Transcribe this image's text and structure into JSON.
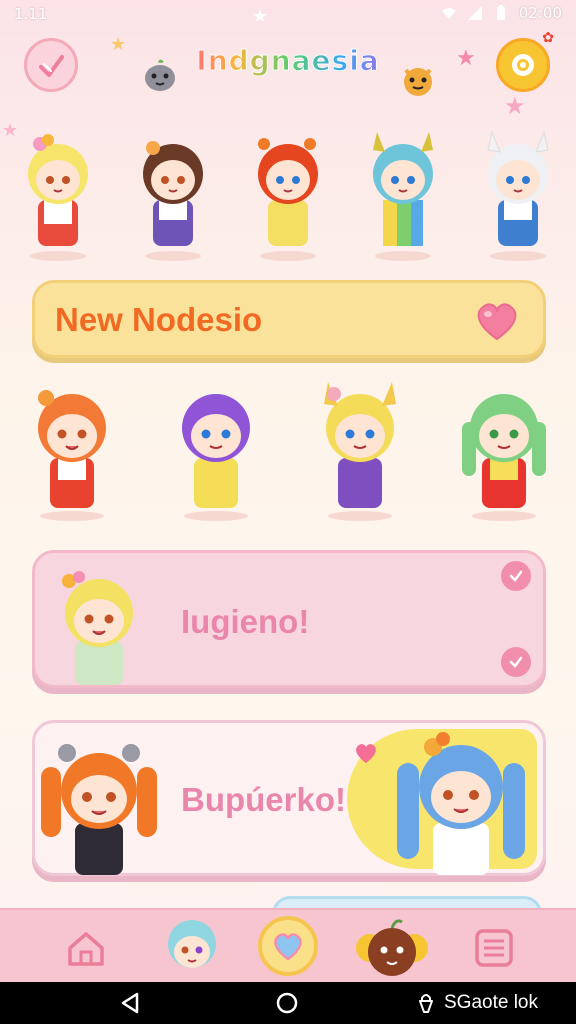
{
  "status_bar": {
    "time": "1.11",
    "clock": "02:00"
  },
  "header": {
    "title": "Indgnaesia"
  },
  "banner": {
    "label": "New Nodesio"
  },
  "cards": [
    {
      "label": "Iugieno!"
    },
    {
      "label": "Bupúerko!"
    }
  ],
  "system_nav": {
    "label": "SGaote lok"
  },
  "colors": {
    "banner_bg": "#fbe29a",
    "banner_text": "#f06a23",
    "card_pink": "#f8d6e0",
    "card_text": "#ea86ac",
    "nav_bg": "#f6c5cf"
  },
  "icons": {
    "back": "check-stroke-icon",
    "settings": "ring-icon",
    "banner": "heart-icon",
    "card_badges": "check-circle-icon",
    "nav": [
      "home-icon",
      "heart-icon",
      "menu-icon"
    ],
    "system": [
      "back-triangle-icon",
      "home-circle-icon",
      "lock-icon"
    ]
  }
}
